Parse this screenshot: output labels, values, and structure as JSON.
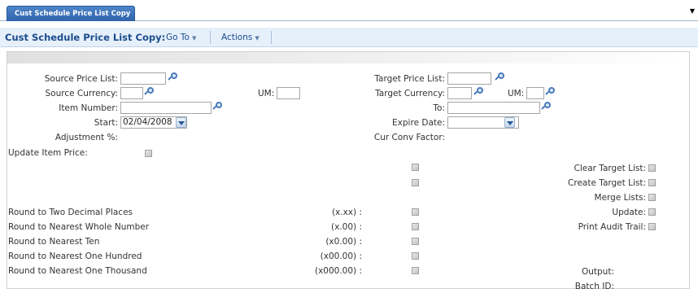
{
  "tab": {
    "label": "Cust Schedule Price List Copy"
  },
  "toolbar": {
    "title": "Cust Schedule Price List Copy:",
    "goto_label": "Go To",
    "actions_label": "Actions"
  },
  "form": {
    "source_price_list_label": "Source Price List:",
    "source_currency_label": "Source Currency:",
    "um_label": "UM:",
    "item_number_label": "Item Number:",
    "start_label": "Start:",
    "start_value": "02/04/2008",
    "adjustment_label": "Adjustment %:",
    "update_item_price_label": "Update Item Price:",
    "target_price_list_label": "Target Price List:",
    "target_currency_label": "Target Currency:",
    "target_um_label": "UM:",
    "to_label": "To:",
    "expire_date_label": "Expire Date:",
    "cur_conv_factor_label": "Cur Conv Factor:",
    "clear_target_list_label": "Clear Target List:",
    "create_target_list_label": "Create Target List:",
    "merge_lists_label": "Merge Lists:",
    "update_label": "Update:",
    "print_audit_trail_label": "Print Audit Trail:",
    "output_label": "Output:",
    "batch_id_label": "Batch ID:"
  },
  "rounding": [
    {
      "label": "Round to Two Decimal Places",
      "format": "(x.xx) :"
    },
    {
      "label": "Round to Nearest Whole Number",
      "format": "(x.00) :"
    },
    {
      "label": "Round to Nearest Ten",
      "format": "(x0.00) :"
    },
    {
      "label": "Round to Nearest One Hundred",
      "format": "(x00.00) :"
    },
    {
      "label": "Round to Nearest One Thousand",
      "format": "(x000.00) :"
    }
  ],
  "icons": {
    "lookup": "magnifier-icon",
    "dropdown": "chevron-down-icon",
    "tab_menu": "triangle-down-icon"
  },
  "colors": {
    "tab": "#3a6fb5",
    "toolbar_bg": "#e6f0fb",
    "toolbar_text": "#1b4c8c"
  }
}
